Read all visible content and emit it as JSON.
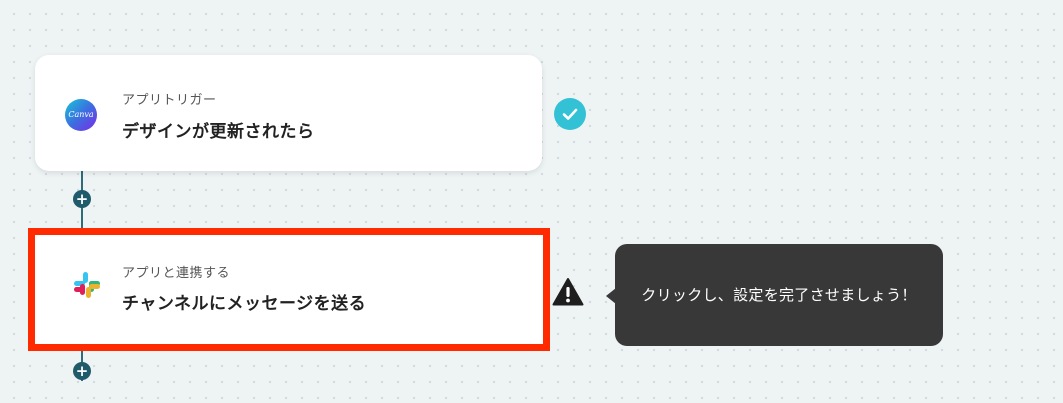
{
  "trigger_step": {
    "sublabel": "アプリトリガー",
    "title": "デザインが更新されたら",
    "icon": "canva-icon",
    "icon_text": "Canva",
    "status": "completed",
    "status_color": "#33c1d6"
  },
  "action_step": {
    "sublabel": "アプリと連携する",
    "title": "チャンネルにメッセージを送る",
    "icon": "slack-icon",
    "status": "warning",
    "highlight_color": "#ff2a00"
  },
  "tooltip": {
    "text": "クリックし、設定を完了させましょう！"
  },
  "add_step_label": "+",
  "colors": {
    "connector": "#2f6b7a",
    "tooltip_bg": "#383838"
  }
}
